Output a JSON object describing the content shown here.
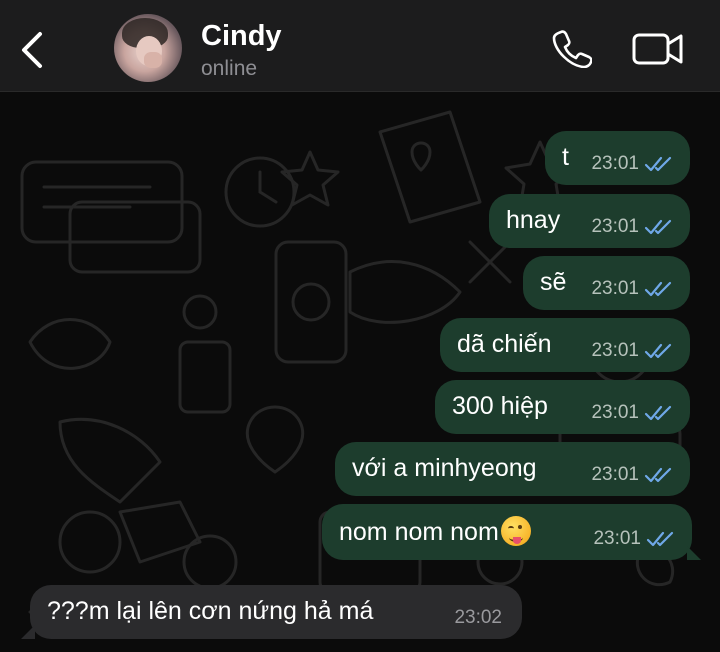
{
  "header": {
    "contact_name": "Cindy",
    "status": "online",
    "icons": [
      "back-chevron-icon",
      "phone-icon",
      "video-camera-icon"
    ]
  },
  "messages": [
    {
      "direction": "outgoing",
      "text": "t",
      "time": "23:01",
      "read": true
    },
    {
      "direction": "outgoing",
      "text": "hnay",
      "time": "23:01",
      "read": true
    },
    {
      "direction": "outgoing",
      "text": "sẽ",
      "time": "23:01",
      "read": true
    },
    {
      "direction": "outgoing",
      "text": "dã chiến",
      "time": "23:01",
      "read": true
    },
    {
      "direction": "outgoing",
      "text": "300 hiệp",
      "time": "23:01",
      "read": true
    },
    {
      "direction": "outgoing",
      "text": "với a minhyeong",
      "time": "23:01",
      "read": true
    },
    {
      "direction": "outgoing",
      "text": "nom nom nom",
      "emoji": "face-savoring-food-emoji",
      "time": "23:01",
      "read": true
    },
    {
      "direction": "incoming",
      "text": "???m lại lên cơn nứng hả má",
      "time": "23:02"
    }
  ],
  "colors": {
    "header_bg": "#1c1c1d",
    "chat_bg": "#0b0b0b",
    "outgoing_bubble": "#1d3d2d",
    "incoming_bubble": "#2b2b2d",
    "read_ticks": "#6fa8e8"
  }
}
